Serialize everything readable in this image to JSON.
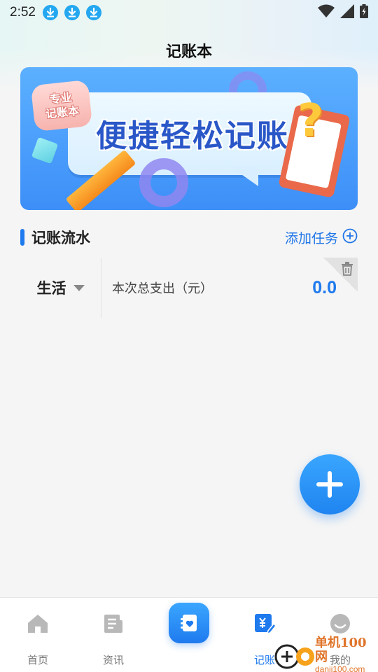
{
  "status_bar": {
    "time": "2:52",
    "download_icons": [
      "download-icon",
      "download-icon",
      "download-icon"
    ],
    "right_icons": [
      "wifi-icon",
      "signal-icon",
      "battery-icon"
    ]
  },
  "header": {
    "title": "记账本"
  },
  "banner": {
    "tag_line1": "专业",
    "tag_line2": "记账本",
    "headline": "便捷轻松记账"
  },
  "section": {
    "title": "记账流水",
    "add_label": "添加任务",
    "accent_color": "#1f7aee"
  },
  "record": {
    "category": "生活",
    "expense_label": "本次总支出（元）",
    "expense_value": "0.0"
  },
  "fab": {
    "icon": "plus-icon"
  },
  "bottom_nav": {
    "items": [
      {
        "label": "首页",
        "icon": "home-icon",
        "active": false
      },
      {
        "label": "资讯",
        "icon": "news-icon",
        "active": false
      },
      {
        "label": "",
        "icon": "notebook-heart-icon",
        "active": false
      },
      {
        "label": "记账",
        "icon": "ledger-icon",
        "active": true
      },
      {
        "label": "我的",
        "icon": "profile-icon",
        "active": false
      }
    ]
  },
  "watermark": {
    "name": "单机100网",
    "url": "danji100.com"
  }
}
